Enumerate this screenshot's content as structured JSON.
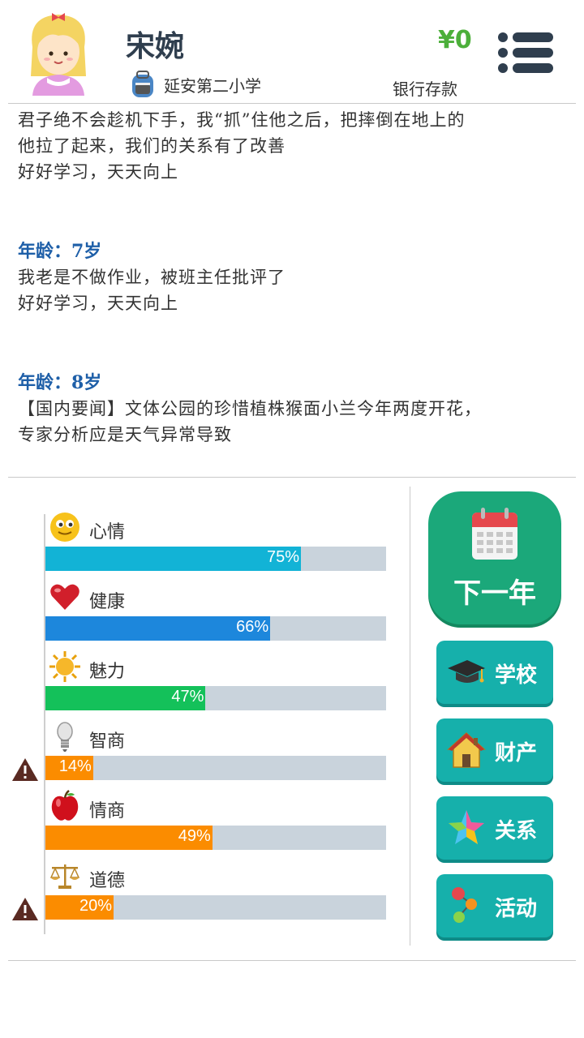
{
  "header": {
    "name": "宋婉",
    "school": "延安第二小学",
    "money": "¥0",
    "bank_label": "银行存款"
  },
  "log": {
    "entry0": {
      "lines": [
        "君子绝不会趁机下手，我“抓”住他之后，把摔倒在地上的",
        "他拉了起来，我们的关系有了改善",
        "好好学习，天天向上"
      ]
    },
    "entry1": {
      "age": "年龄：7岁",
      "lines": [
        "我老是不做作业，被班主任批评了",
        "好好学习，天天向上"
      ]
    },
    "entry2": {
      "age": "年龄：8岁",
      "lines": [
        "【国内要闻】文体公园的珍惜植株猴面小兰今年两度开花，",
        "专家分析应是天气异常导致"
      ]
    }
  },
  "stats": [
    {
      "label": "心情",
      "value": 75,
      "pct": "75%",
      "color": "#12b3d6",
      "icon": "smiley-icon",
      "warning": false
    },
    {
      "label": "健康",
      "value": 66,
      "pct": "66%",
      "color": "#1d87dc",
      "icon": "heart-icon",
      "warning": false
    },
    {
      "label": "魅力",
      "value": 47,
      "pct": "47%",
      "color": "#14c15a",
      "icon": "sun-icon",
      "warning": false
    },
    {
      "label": "智商",
      "value": 14,
      "pct": "14%",
      "color": "#fb8c00",
      "icon": "lightbulb-icon",
      "warning": true
    },
    {
      "label": "情商",
      "value": 49,
      "pct": "49%",
      "color": "#fb8c00",
      "icon": "apple-icon",
      "warning": false
    },
    {
      "label": "道德",
      "value": 20,
      "pct": "20%",
      "color": "#fb8c00",
      "icon": "scales-icon",
      "warning": true
    }
  ],
  "buttons": {
    "next_year": "下一年",
    "school": "学校",
    "property": "财产",
    "relations": "关系",
    "activities": "活动"
  },
  "icons": {
    "menu": "menu-icon",
    "warning": "warning-icon",
    "calendar": "calendar-icon",
    "graduation_cap": "graduation-cap-icon",
    "house": "house-icon",
    "star": "star-icon",
    "activity": "activity-icon",
    "backpack": "school-bag-icon"
  },
  "colors": {
    "primary_green": "#1ba87a",
    "button_teal": "#16b0ab",
    "money_green": "#4caf3a",
    "age_blue": "#1e5fa8"
  }
}
